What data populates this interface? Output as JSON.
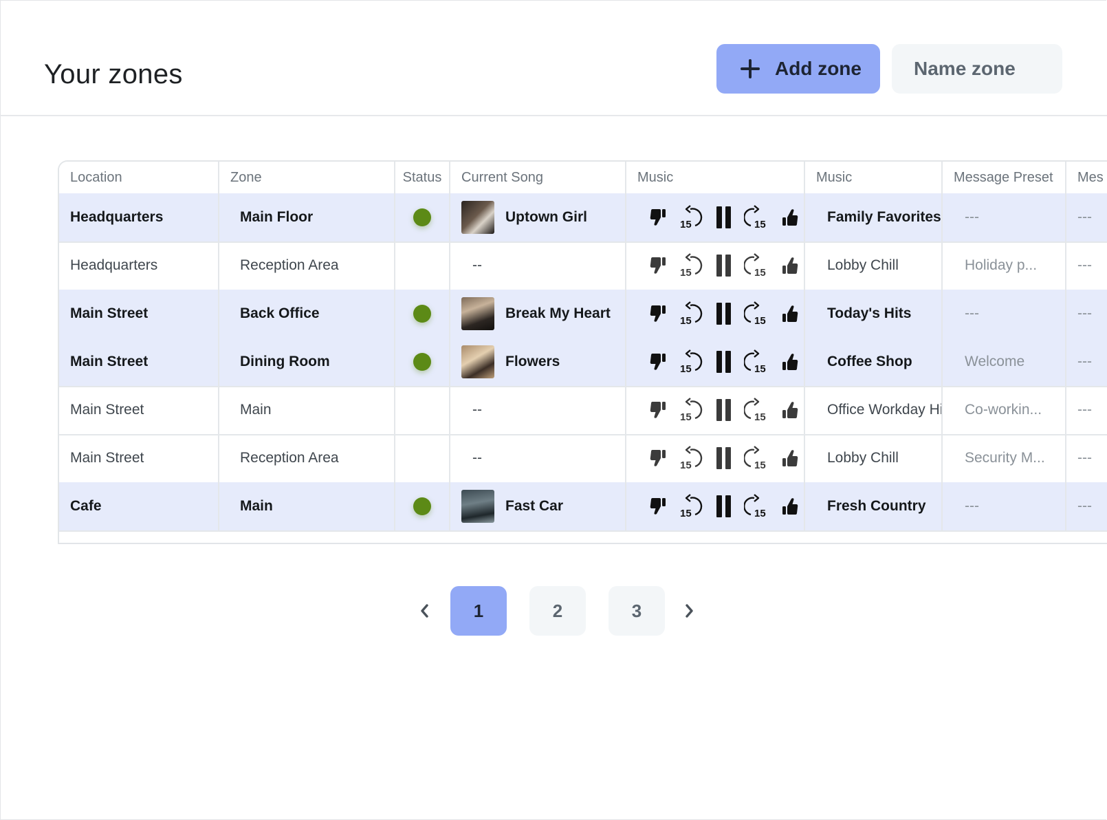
{
  "header": {
    "title": "Your zones",
    "add_label": "Add zone",
    "name_label": "Name zone"
  },
  "table": {
    "columns": [
      "Location",
      "Zone",
      "Status",
      "Current Song",
      "Music",
      "Music",
      "Message Preset",
      "Mes"
    ],
    "rows": [
      {
        "location": "Headquarters",
        "zone": "Main Floor",
        "online": true,
        "song": "Uptown Girl",
        "music": "Family Favorites",
        "preset": "---",
        "extra": "---"
      },
      {
        "location": "Headquarters",
        "zone": "Reception Area",
        "online": false,
        "song": "--",
        "music": "Lobby Chill",
        "preset": "Holiday p...",
        "extra": "---"
      },
      {
        "location": "Main Street",
        "zone": "Back Office",
        "online": true,
        "song": "Break My Heart",
        "music": "Today's Hits",
        "preset": "---",
        "extra": "---"
      },
      {
        "location": "Main Street",
        "zone": "Dining Room",
        "online": true,
        "song": "Flowers",
        "music": "Coffee Shop",
        "preset": "Welcome",
        "extra": "---"
      },
      {
        "location": "Main Street",
        "zone": "Main",
        "online": false,
        "song": "--",
        "music": "Office Workday Hi",
        "preset": "Co-workin...",
        "extra": "---"
      },
      {
        "location": "Main Street",
        "zone": "Reception Area",
        "online": false,
        "song": "--",
        "music": "Lobby Chill",
        "preset": "Security M...",
        "extra": "---"
      },
      {
        "location": "Cafe",
        "zone": "Main",
        "online": true,
        "song": "Fast Car",
        "music": "Fresh Country",
        "preset": "---",
        "extra": "---"
      }
    ]
  },
  "icons": {
    "dislike": "thumbs-down-icon",
    "rewind": "rewind-15-icon",
    "pause": "pause-icon",
    "forward": "forward-15-icon",
    "like": "thumbs-up-icon",
    "skip_seconds": "15"
  },
  "colors": {
    "accent": "#92a9f6",
    "status_online": "#5c8a16",
    "row_active": "#e6ebfb"
  },
  "pagination": {
    "pages": [
      "1",
      "2",
      "3"
    ],
    "current": "1"
  }
}
